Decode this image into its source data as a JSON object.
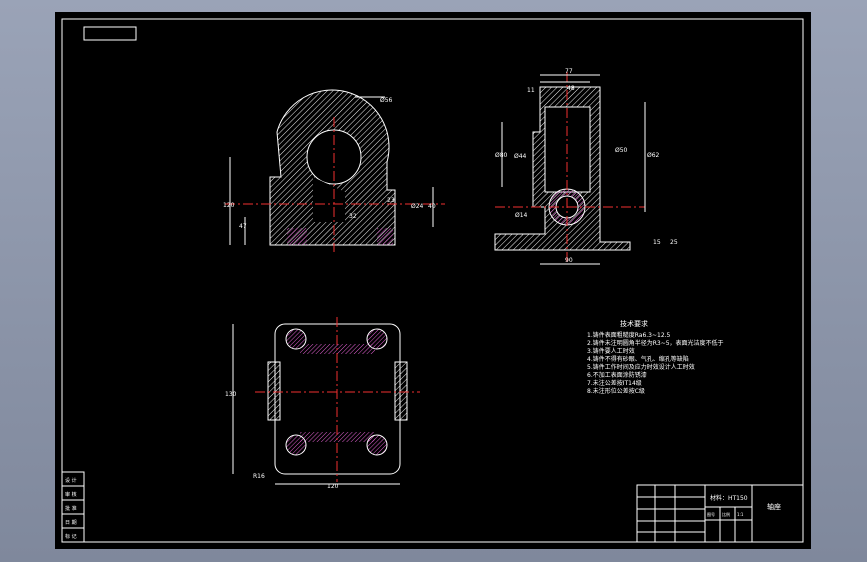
{
  "dimensions": {
    "d_top_right": "Ø56",
    "d_dim_120": "120",
    "d_dim_47": "47",
    "d_dim_32": "32",
    "d_dim_23": "23",
    "d_dim_24": "Ø24",
    "d_dim_40": "40",
    "d_dim_77": "77",
    "d_dim_48": "48",
    "d_dim_11": "11",
    "d_dim_80": "Ø80",
    "d_dim_44": "Ø44",
    "d_dim_50": "Ø50",
    "d_dim_62": "Ø62",
    "d_dim_14": "Ø14",
    "d_dim_15": "15",
    "d_dim_25": "25",
    "d_dim_90": "90",
    "d_plan_130": "130",
    "d_plan_120": "120",
    "d_plan_r16": "R16"
  },
  "tech_notes": {
    "title": "技术要求",
    "items": [
      "1.铸件表面粗糙度Ra6.3~12.5",
      "2.铸件未注明圆角半径为R3~5，表面光洁度不低于",
      "3.铸件要人工时效",
      "4.铸件不得有砂眼、气孔、缩孔等缺陷",
      "5.铸件工作时间及应力时效设计人工时效",
      "6.不加工表面涂防锈漆",
      "7.未注公差按IT14级",
      "8.未注形位公差按C级"
    ]
  },
  "title_block": {
    "material": "材料：HT150",
    "part_name": "轴座",
    "scale_cells": [
      "图号",
      "比例",
      "1:1"
    ],
    "left_labels": [
      "设 计",
      "审 核",
      "批 准",
      "日 期",
      "标 记"
    ]
  }
}
